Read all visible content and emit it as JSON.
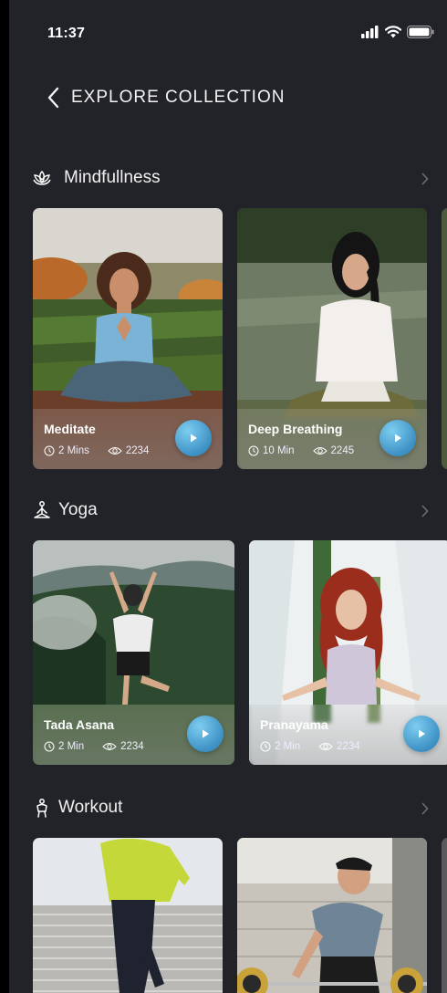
{
  "status": {
    "time": "11:37"
  },
  "header": {
    "title": "EXPLORE COLLECTION"
  },
  "sections": [
    {
      "title": "Mindfullness",
      "icon": "lotus-icon",
      "cards": [
        {
          "title": "Meditate",
          "duration": "2 Mins",
          "views": "2234"
        },
        {
          "title": "Deep Breathing",
          "duration": "10 Min",
          "views": "2245"
        }
      ]
    },
    {
      "title": "Yoga",
      "icon": "yoga-pose-icon",
      "cards": [
        {
          "title": "Tada Asana",
          "duration": "2 Min",
          "views": "2234"
        },
        {
          "title": "Pranayama",
          "duration": "2 Min",
          "views": "2234"
        }
      ]
    },
    {
      "title": "Workout",
      "icon": "workout-icon",
      "cards": [
        {
          "title": "",
          "duration": "",
          "views": ""
        },
        {
          "title": "",
          "duration": "",
          "views": ""
        }
      ]
    }
  ],
  "colors": {
    "background": "#222328",
    "accent": "#3d91c4"
  }
}
